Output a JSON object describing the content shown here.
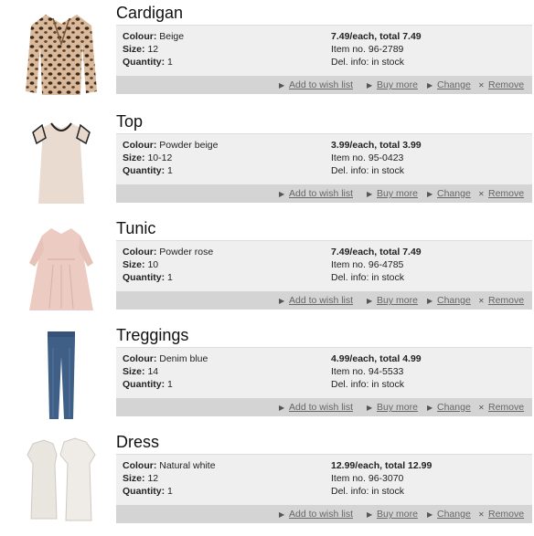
{
  "labels": {
    "colour": "Colour:",
    "size": "Size:",
    "quantity": "Quantity:",
    "add_to_wish_list": "Add to wish list",
    "buy_more": "Buy more",
    "change": "Change",
    "remove": "Remove"
  },
  "items": [
    {
      "name": "Cardigan",
      "colour": "Beige",
      "size": "12",
      "quantity": "1",
      "price": "7.49/each, total 7.49",
      "item_no": "Item no. 96-2789",
      "del_info": "Del. info: in stock",
      "image": "cardigan-image"
    },
    {
      "name": "Top",
      "colour": "Powder beige",
      "size": "10-12",
      "quantity": "1",
      "price": "3.99/each, total 3.99",
      "item_no": "Item no. 95-0423",
      "del_info": "Del. info: in stock",
      "image": "top-image"
    },
    {
      "name": "Tunic",
      "colour": "Powder rose",
      "size": "10",
      "quantity": "1",
      "price": "7.49/each, total 7.49",
      "item_no": "Item no. 96-4785",
      "del_info": "Del. info: in stock",
      "image": "tunic-image"
    },
    {
      "name": "Treggings",
      "colour": "Denim blue",
      "size": "14",
      "quantity": "1",
      "price": "4.99/each, total 4.99",
      "item_no": "Item no. 94-5533",
      "del_info": "Del. info: in stock",
      "image": "treggings-image"
    },
    {
      "name": "Dress",
      "colour": "Natural white",
      "size": "12",
      "quantity": "1",
      "price": "12.99/each, total 12.99",
      "item_no": "Item no. 96-3070",
      "del_info": "Del. info: in stock",
      "image": "dress-image"
    }
  ],
  "icons": {
    "action_arrow": "arrow-right-icon",
    "remove": "close-icon"
  },
  "colors": {
    "details_bg": "#efefef",
    "actions_bg": "#d4d4d4",
    "link": "#666666"
  }
}
